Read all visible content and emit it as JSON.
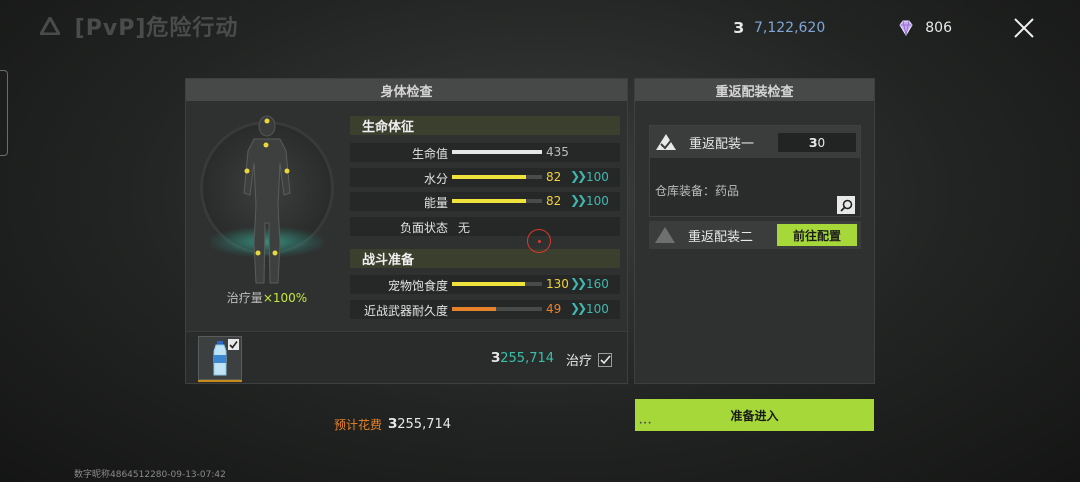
{
  "top": {
    "title": "[PvP]危险行动",
    "money": "7,122,620",
    "gems": "806"
  },
  "body_check": {
    "header": "身体检查",
    "heal_amount_label": "治疗量",
    "heal_amount_value": "×100%",
    "vitals_section": "生命体征",
    "vitals": [
      {
        "label": "生命值",
        "current": "435",
        "max": "",
        "fill": 1.0,
        "color": "#e6e6e6",
        "cur_color": "#bdbdbd"
      },
      {
        "label": "水分",
        "current": "82",
        "max": "100",
        "fill": 0.82,
        "color": "#f0e23c",
        "cur_color": "#f0d23c"
      },
      {
        "label": "能量",
        "current": "82",
        "max": "100",
        "fill": 0.82,
        "color": "#f0e23c",
        "cur_color": "#f0d23c"
      }
    ],
    "debuff_label": "负面状态",
    "debuff_value": "无",
    "combat_section": "战斗准备",
    "combat": [
      {
        "label": "宠物饱食度",
        "current": "130",
        "max": "160",
        "fill": 0.81,
        "color": "#f0e23c",
        "cur_color": "#f0d23c"
      },
      {
        "label": "近战武器耐久度",
        "current": "49",
        "max": "100",
        "fill": 0.49,
        "color": "#e8822a",
        "cur_color": "#e8822a"
      }
    ],
    "heal_cost": "255,714",
    "heal_toggle_label": "治疗"
  },
  "reload_check": {
    "header": "重返配装检查",
    "loadout1_name": "重返配装一",
    "loadout1_cost": "0",
    "warehouse_label": "仓库装备：药品",
    "loadout2_name": "重返配装二",
    "goto_button": "前往配置"
  },
  "footer": {
    "est_cost_label": "预计花费",
    "est_cost_value": "255,714",
    "ready_button": "准备进入",
    "watermark": "数字昵称4864512280-09-13-07:42"
  },
  "colors": {
    "accent_green": "#a6d83a",
    "teal": "#3fb8b0",
    "yellow": "#f0e23c",
    "orange": "#e8822a"
  }
}
